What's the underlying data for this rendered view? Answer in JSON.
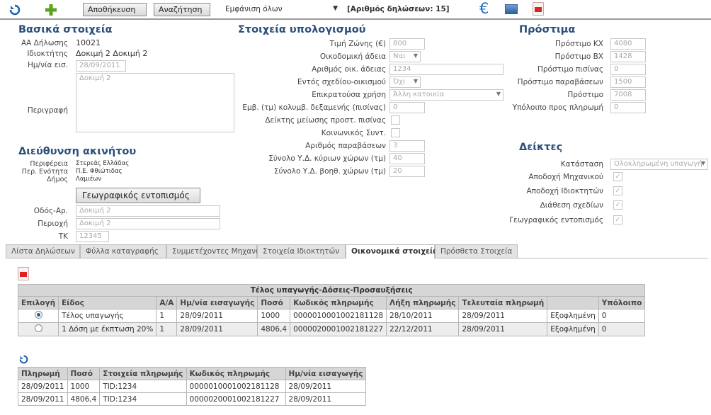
{
  "toolbar": {
    "save_label": "Αποθήκευση",
    "search_label": "Αναζήτηση",
    "show_select": "Εμφάνιση όλων",
    "count_text": "[Αριθμός δηλώσεων: 15]"
  },
  "basic": {
    "title": "Βασικά στοιχεία",
    "aa_label": "ΑΑ Δήλωσης",
    "aa_value": "10021",
    "owner_label": "Ιδιοκτήτης",
    "owner_value": "Δοκιμή 2 Δοκιμή 2",
    "date_label": "Ημ/νία εισ.",
    "date_value": "28/09/2011",
    "desc_label": "Περιγραφή",
    "desc_value": "Δοκιμή 2"
  },
  "address": {
    "title": "Διεύθυνση ακινήτου",
    "region_label": "Περιφέρεια",
    "region_value": "Στερεάς Ελλάδας",
    "unit_label": "Περ. Ενότητα",
    "unit_value": "Π.Ε. Φθιώτιδας",
    "municipality_label": "Δήμος",
    "municipality_value": "Λαμιέων",
    "geo_button": "Γεωγραφικός εντοπισμός",
    "street_label": "Οδός-Αρ.",
    "street_value": "Δοκιμή 2",
    "area_label": "Περιοχή",
    "area_value": "Δοκιμή 2",
    "tk_label": "ΤΚ",
    "tk_value": "12345"
  },
  "calc": {
    "title": "Στοιχεία υπολογισμού",
    "zone_label": "Τιμή Ζώνης (€)",
    "zone_value": "800",
    "permit_label": "Οικοδομική άδεια",
    "permit_value": "Ναι",
    "permit_no_label": "Αριθμός οικ. άδειας",
    "permit_no_value": "1234",
    "plan_label": "Εντός σχεδίου-οικισμού",
    "plan_value": "Όχι",
    "use_label": "Επικρατούσα χρήση",
    "use_value": "Άλλη κατοικία",
    "pool_label": "Εμβ. (τμ) κολυμβ. δεξαμενής (πισίνας)",
    "pool_value": "0",
    "pool_reduce_label": "Δείκτης μείωσης προστ. πισίνας",
    "social_label": "Κοινωνικός Συντ.",
    "violations_label": "Αριθμός παραβάσεων",
    "violations_value": "3",
    "main_area_label": "Σύνολο Υ.Δ. κύριων χώρων (τμ)",
    "main_area_value": "40",
    "aux_area_label": "Σύνολο Υ.Δ. βοηθ. χώρων (τμ)",
    "aux_area_value": "20"
  },
  "fines": {
    "title": "Πρόστιμα",
    "kx_label": "Πρόστιμο ΚΧ",
    "kx_value": "4080",
    "bx_label": "Πρόστιμο ΒΧ",
    "bx_value": "1428",
    "pool_label": "Πρόστιμο πισίνας",
    "pool_value": "0",
    "viol_label": "Πρόστιμο παραβάσεων",
    "viol_value": "1500",
    "total_label": "Πρόστιμο",
    "total_value": "7008",
    "remain_label": "Υπόλοιπο προς πληρωμή",
    "remain_value": "0"
  },
  "indicators": {
    "title": "Δείκτες",
    "status_label": "Κατάσταση",
    "status_value": "Ολοκληρωμένη υπαγωγή",
    "eng_label": "Αποδοχή Μηχανικού",
    "owners_label": "Αποδοχή Ιδιοκτητών",
    "plans_label": "Διάθεση σχεδίων",
    "geo_label": "Γεωγραφικός εντοπισμός"
  },
  "tabs": [
    {
      "label": "Λίστα Δηλώσεων"
    },
    {
      "label": "Φύλλα καταγραφής"
    },
    {
      "label": "Συμμετέχοντες Μηχανικοί"
    },
    {
      "label": "Στοιχεία Ιδιοκτητών"
    },
    {
      "label": "Οικονομικά στοιχεία"
    },
    {
      "label": "Πρόσθετα Στοιχεία"
    }
  ],
  "fees_table": {
    "caption": "Τέλος υπαγωγής-Δόσεις-Προσαυξήσεις",
    "headers": [
      "Επιλογή",
      "Είδος",
      "Α/Α",
      "Ημ/νία εισαγωγής",
      "Ποσό",
      "Κωδικός πληρωμής",
      "Λήξη πληρωμής",
      "Τελευταία πληρωμή",
      "",
      "Υπόλοιπο"
    ],
    "rows": [
      [
        "Τέλος υπαγωγής",
        "1",
        "28/09/2011",
        "1000",
        "0000010001002181128",
        "28/10/2011",
        "28/09/2011",
        "Εξοφλημένη",
        "0"
      ],
      [
        "1 Δόση με έκπτωση 20%",
        "1",
        "28/09/2011",
        "4806,4",
        "0000020001002181227",
        "22/12/2011",
        "28/09/2011",
        "Εξοφλημένη",
        "0"
      ]
    ]
  },
  "payments_table": {
    "headers": [
      "Πληρωμή",
      "Ποσό",
      "Στοιχεία πληρωμής",
      "Κωδικός πληρωμής",
      "Ημ/νία εισαγωγής"
    ],
    "rows": [
      [
        "28/09/2011",
        "1000",
        "TID:1234",
        "0000010001002181128",
        "28/09/2011"
      ],
      [
        "28/09/2011",
        "4806,4",
        "TID:1234",
        "0000020001002181227",
        "28/09/2011"
      ]
    ]
  }
}
